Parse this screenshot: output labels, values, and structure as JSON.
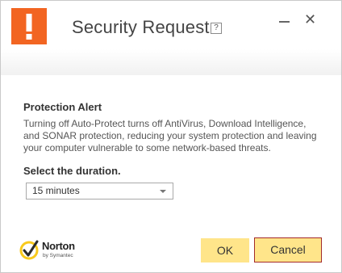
{
  "window": {
    "title": "Security Request",
    "help_label": "?",
    "close_label": "✕"
  },
  "alert": {
    "heading": "Protection Alert",
    "description": "Turning off Auto-Protect turns off AntiVirus, Download Intelligence, and SONAR protection, reducing your system protection and leaving your computer vulnerable to some network-based threats."
  },
  "duration": {
    "label": "Select the duration.",
    "selected": "15 minutes"
  },
  "brand": {
    "name": "Norton",
    "tagline": "by Symantec"
  },
  "buttons": {
    "ok_label": "OK",
    "cancel_label": "Cancel"
  },
  "colors": {
    "alert_orange": "#f26522",
    "button_yellow": "#ffe58a",
    "cancel_border": "#a22a2a",
    "norton_yellow": "#f8c91c"
  }
}
